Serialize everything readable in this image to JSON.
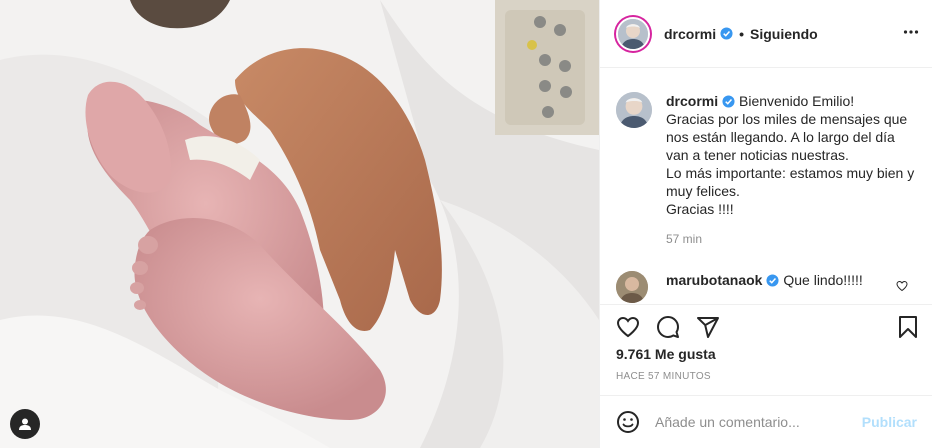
{
  "post": {
    "author": "drcormi",
    "follow_status": "Siguiendo",
    "dot": "•",
    "caption": {
      "username": "drcormi",
      "text": "Bienvenido Emilio!\nGracias por los miles de mensajes que nos están llegando. A lo largo del día van a tener noticias nuestras.\nLo más importante: estamos muy bien y muy felices.\nGracias !!!!",
      "time": "57 min"
    },
    "comment": {
      "username": "marubotanaok",
      "text": "Que lindo!!!!!"
    },
    "likes": "9.761 Me gusta",
    "posted_ago": "HACE 57 MINUTOS",
    "comment_placeholder": "Añade un comentario...",
    "publish_label": "Publicar"
  },
  "icons": {
    "verified": "verified-badge-icon",
    "more": "more-options-icon",
    "like": "heart-icon",
    "comment": "comment-icon",
    "share": "share-icon",
    "save": "bookmark-icon",
    "emoji": "emoji-icon",
    "tag": "user-tag-icon"
  },
  "colors": {
    "verified_blue": "#3897f0",
    "publish_disabled": "#b2dffc",
    "secondary_text": "#8e8e8e"
  }
}
